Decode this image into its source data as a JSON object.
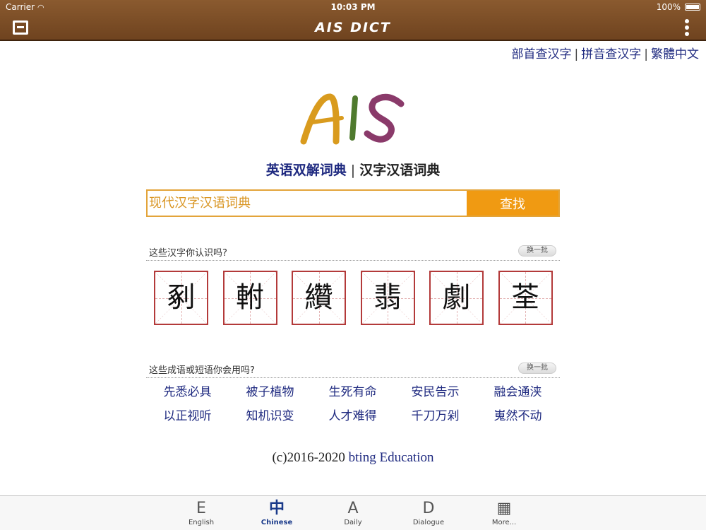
{
  "status": {
    "carrier": "Carrier",
    "time": "10:03 PM",
    "battery": "100%"
  },
  "nav": {
    "title": "AIS DICT"
  },
  "top_links": {
    "radical": "部首查汉字",
    "pinyin": "拼音查汉字",
    "traditional": "繁體中文",
    "separator": "|"
  },
  "dict_switch": {
    "english": "英语双解词典",
    "chinese": "汉字汉语词典",
    "separator": "|"
  },
  "search": {
    "placeholder": "现代汉字汉语词典",
    "button": "查找"
  },
  "chars_section": {
    "label": "这些汉字你认识吗?",
    "refresh": "换一批",
    "items": [
      "剢",
      "軵",
      "纘",
      "翡",
      "劇",
      "荃"
    ]
  },
  "idioms_section": {
    "label": "这些成语或短语你会用吗?",
    "refresh": "换一批",
    "items": [
      "先悉必具",
      "被子植物",
      "生死有命",
      "安民告示",
      "融会通浃",
      "以正视听",
      "知机识变",
      "人才难得",
      "千刀万剁",
      "嵬然不动"
    ]
  },
  "footer": {
    "prefix": "(c)2016-2020 ",
    "brand": "bting Education"
  },
  "tabs": [
    {
      "label": "English",
      "icon": "E"
    },
    {
      "label": "Chinese",
      "icon": "中"
    },
    {
      "label": "Daily",
      "icon": "A"
    },
    {
      "label": "Dialogue",
      "icon": "D"
    },
    {
      "label": "More...",
      "icon": "▦"
    }
  ],
  "colors": {
    "nav": "#7a4c25",
    "accent": "#f09a12",
    "link": "#1f2a80",
    "char_border": "#b33a3a"
  }
}
